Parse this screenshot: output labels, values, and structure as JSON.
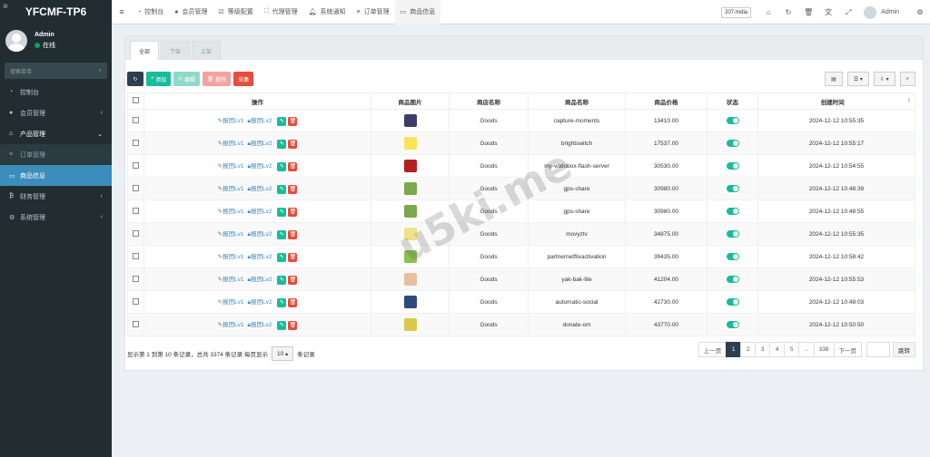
{
  "app": {
    "title": "YFCMF-TP6"
  },
  "user": {
    "name": "Admin",
    "status": "在线"
  },
  "sidebar": {
    "search_placeholder": "搜索菜单",
    "items": [
      {
        "label": "控制台",
        "icon": "dashboard-icon"
      },
      {
        "label": "会员管理",
        "icon": "user-icon",
        "caret": "‹"
      },
      {
        "label": "产品管理",
        "icon": "home-icon",
        "caret": "⌄"
      },
      {
        "label": "订单管理",
        "icon": "list-icon"
      },
      {
        "label": "商品信息",
        "icon": "desktop-icon"
      },
      {
        "label": "财务管理",
        "icon": "money-icon",
        "caret": "‹"
      },
      {
        "label": "系统管理",
        "icon": "cogs-icon",
        "caret": "‹"
      }
    ]
  },
  "topbar": {
    "tabs": [
      "控制台",
      "会员管理",
      "等级配置",
      "代理管理",
      "系统通知",
      "订单管理",
      "商品信息"
    ],
    "region": "207-India",
    "user": "Admin"
  },
  "filter_tabs": [
    "全部",
    "下架",
    "上架"
  ],
  "toolbar": {
    "add": "添加",
    "edit": "编辑",
    "delete": "删除",
    "collect": "采集"
  },
  "table": {
    "headers": [
      "操作",
      "商品图片",
      "商店名称",
      "商品名称",
      "商品价格",
      "状态",
      "创建时间"
    ],
    "op_lv1": "报团Lv1",
    "op_lv2": "报团Lv2",
    "rows": [
      {
        "shop": "Goods",
        "name": "capture-moments",
        "price": "13410.00",
        "time": "2024-12-12 10:55:35",
        "thumb_color": "#3d3d6b"
      },
      {
        "shop": "Goods",
        "name": "brightswitch",
        "price": "17537.00",
        "time": "2024-12-12 10:55:17",
        "thumb_color": "#f7e45a"
      },
      {
        "shop": "Goods",
        "name": "my-vodobox-flash-server",
        "price": "30530.00",
        "time": "2024-12-12 10:54:55",
        "thumb_color": "#b32020"
      },
      {
        "shop": "Goods",
        "name": "gps-share",
        "price": "30980.00",
        "time": "2024-12-12 10:48:39",
        "thumb_color": "#7aa84a"
      },
      {
        "shop": "Goods",
        "name": "gps-share",
        "price": "30980.00",
        "time": "2024-12-12 10:48:55",
        "thumb_color": "#7aa84a"
      },
      {
        "shop": "Goods",
        "name": "movyztv",
        "price": "34875.00",
        "time": "2024-12-12 10:55:35",
        "thumb_color": "#f0e28a"
      },
      {
        "shop": "Goods",
        "name": "partnernetflixactivation",
        "price": "39435.00",
        "time": "2024-12-12 10:58:42",
        "thumb_color": "#8cc152"
      },
      {
        "shop": "Goods",
        "name": "yak-bak-lite",
        "price": "41204.00",
        "time": "2024-12-12 10:55:53",
        "thumb_color": "#e8c0a0"
      },
      {
        "shop": "Goods",
        "name": "automatic-social",
        "price": "42730.00",
        "time": "2024-12-12 10:48:03",
        "thumb_color": "#2d4a7a"
      },
      {
        "shop": "Goods",
        "name": "donate-om",
        "price": "43770.00",
        "time": "2024-12-12 10:50:50",
        "thumb_color": "#d9c84a"
      }
    ]
  },
  "footer": {
    "summary": "显示第 1 到第 10 条记录，总共 3374 条记录 每页显示",
    "page_size": "10 ▴",
    "suffix": "条记录"
  },
  "pagination": {
    "prev": "上一页",
    "pages": [
      "1",
      "2",
      "3",
      "4",
      "5",
      "...",
      "338"
    ],
    "next": "下一页",
    "jump": "跳转"
  },
  "watermark": "u5ki.me"
}
